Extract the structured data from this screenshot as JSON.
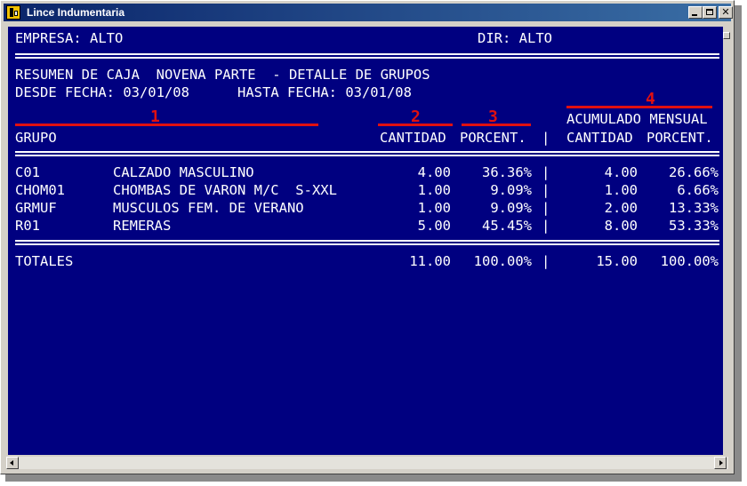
{
  "window": {
    "title": "Lince Indumentaria"
  },
  "header": {
    "empresa": "EMPRESA: ALTO",
    "dir": "DIR: ALTO"
  },
  "report": {
    "title": "RESUMEN DE CAJA  NOVENA PARTE  - DETALLE DE GRUPOS",
    "desde": "DESDE FECHA: 03/01/08",
    "hasta": "HASTA FECHA: 03/01/08"
  },
  "annotations": [
    "1",
    "2",
    "3",
    "4"
  ],
  "annotation_color": "#e01010",
  "screen_background": "#000080",
  "columns": {
    "acumulado": "ACUMULADO MENSUAL",
    "grupo": "GRUPO",
    "cantidad": "CANTIDAD",
    "porcent": "PORCENT.",
    "sep": "|",
    "acum_cantidad": "CANTIDAD",
    "acum_porcent": "PORCENT."
  },
  "rows": [
    {
      "code": "C01",
      "desc": "CALZADO MASCULINO",
      "cantidad": "4.00",
      "porcent": "36.36%",
      "sep": "|",
      "acum_cantidad": "4.00",
      "acum_porcent": "26.66%"
    },
    {
      "code": "CHOM01",
      "desc": "CHOMBAS DE VARON M/C  S-XXL",
      "cantidad": "1.00",
      "porcent": "9.09%",
      "sep": "|",
      "acum_cantidad": "1.00",
      "acum_porcent": "6.66%"
    },
    {
      "code": "GRMUF",
      "desc": "MUSCULOS FEM. DE VERANO",
      "cantidad": "1.00",
      "porcent": "9.09%",
      "sep": "|",
      "acum_cantidad": "2.00",
      "acum_porcent": "13.33%"
    },
    {
      "code": "R01",
      "desc": "REMERAS",
      "cantidad": "5.00",
      "porcent": "45.45%",
      "sep": "|",
      "acum_cantidad": "8.00",
      "acum_porcent": "53.33%"
    }
  ],
  "totals": {
    "label": "TOTALES",
    "cantidad": "11.00",
    "porcent": "100.00%",
    "sep": "|",
    "acum_cantidad": "15.00",
    "acum_porcent": "100.00%"
  }
}
